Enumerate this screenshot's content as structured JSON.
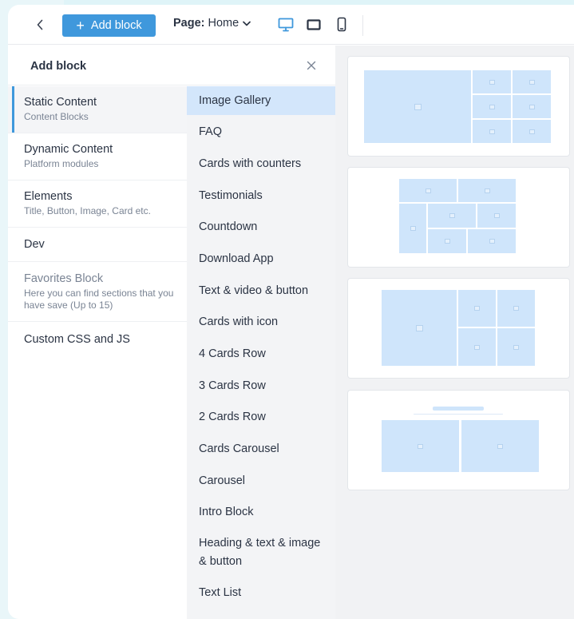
{
  "toolbar": {
    "back_icon": "chevron-left-icon",
    "add_block_label": "Add block",
    "page_label": "Page:",
    "page_value": "Home",
    "devices": [
      "desktop-icon",
      "tablet-icon",
      "mobile-icon"
    ],
    "active_device": "desktop",
    "accent_color": "#3f98dc"
  },
  "panel": {
    "title": "Add block",
    "categories": [
      {
        "title": "Static Content",
        "subtitle": "Content Blocks",
        "active": true
      },
      {
        "title": "Dynamic Content",
        "subtitle": "Platform modules"
      },
      {
        "title": "Elements",
        "subtitle": "Title, Button, Image, Card etc."
      },
      {
        "title": "Dev",
        "subtitle": ""
      },
      {
        "title": "Favorites Block",
        "subtitle": "Here you can find sections that you have save (Up to 15)"
      },
      {
        "title": "Custom CSS and JS",
        "subtitle": ""
      }
    ],
    "blocks": [
      "Image Gallery",
      "FAQ",
      "Cards with counters",
      "Testimonials",
      "Countdown",
      "Download App",
      "Text & video & button",
      "Cards with icon",
      "4 Cards Row",
      "3 Cards Row",
      "2 Cards Row",
      "Cards Carousel",
      "Carousel",
      "Intro Block",
      "Heading & text & image & button",
      "Text List"
    ],
    "selected_block": "Image Gallery"
  }
}
